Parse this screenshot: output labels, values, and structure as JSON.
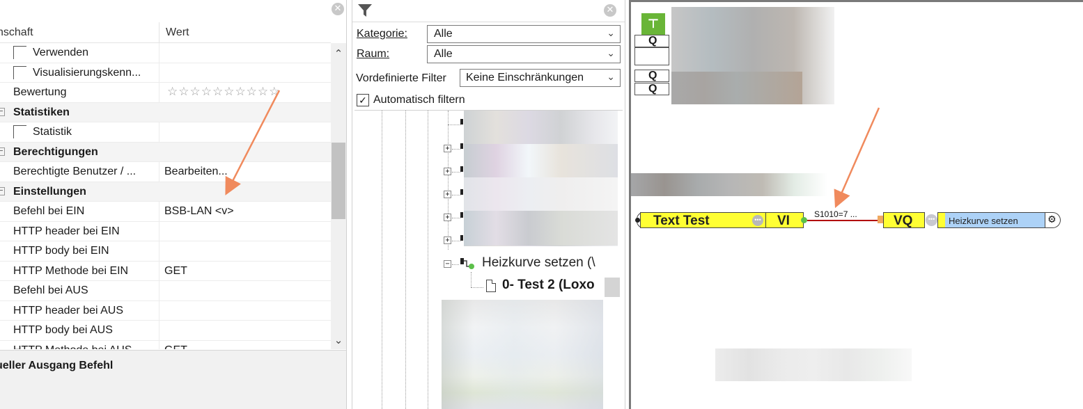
{
  "properties": {
    "header": {
      "name_col": "nschaft",
      "value_col": "Wert"
    },
    "rows": [
      {
        "type": "checkbox",
        "name": "Verwenden",
        "value": ""
      },
      {
        "type": "checkbox",
        "name": "Visualisierungskenn...",
        "value": ""
      },
      {
        "type": "stars",
        "name": "Bewertung",
        "value": "☆☆☆☆☆☆☆☆☆☆"
      },
      {
        "type": "group",
        "name": "Statistiken"
      },
      {
        "type": "checkbox",
        "name": "Statistik",
        "value": ""
      },
      {
        "type": "group",
        "name": "Berechtigungen"
      },
      {
        "type": "plain",
        "name": "Berechtigte Benutzer / ...",
        "value": "Bearbeiten..."
      },
      {
        "type": "group",
        "name": "Einstellungen"
      },
      {
        "type": "plain",
        "name": "Befehl bei EIN",
        "value": "BSB-LAN <v>"
      },
      {
        "type": "plain",
        "name": "HTTP header bei EIN",
        "value": ""
      },
      {
        "type": "plain",
        "name": "HTTP body bei EIN",
        "value": ""
      },
      {
        "type": "plain",
        "name": "HTTP Methode bei EIN",
        "value": "GET"
      },
      {
        "type": "plain",
        "name": "Befehl bei AUS",
        "value": ""
      },
      {
        "type": "plain",
        "name": "HTTP header bei AUS",
        "value": ""
      },
      {
        "type": "plain",
        "name": "HTTP body bei AUS",
        "value": ""
      },
      {
        "type": "plain",
        "name": "HTTP Methode bei AUS",
        "value": "GET"
      }
    ],
    "bottom_title": "ueller Ausgang Befehl"
  },
  "filter": {
    "kategorie_label": "Kategorie:",
    "kategorie_value": "Alle",
    "raum_label": "Raum:",
    "raum_value": "Alle",
    "vordefiniert_label": "Vordefinierte Filter",
    "vordefiniert_value": "Keine Einschränkungen",
    "auto_filter_label": "Automatisch filtern",
    "tree": {
      "node_heiz": "Heizkurve setzen (\\",
      "node_test2": "0- Test 2 (Loxo"
    }
  },
  "canvas": {
    "q_labels": [
      "Q",
      "Q",
      "Q"
    ],
    "block_texttest": "Text Test",
    "block_vi": "VI",
    "wire_label": "S1010=7 ...",
    "block_vq": "VQ",
    "block_heiz": "Heizkurve setzen"
  },
  "colors": {
    "block_yellow": "#ffff33",
    "block_blue": "#add2f7",
    "wire_red": "#b20000",
    "annotation_arrow": "#f08a5d",
    "pin_green": "#69b537"
  }
}
